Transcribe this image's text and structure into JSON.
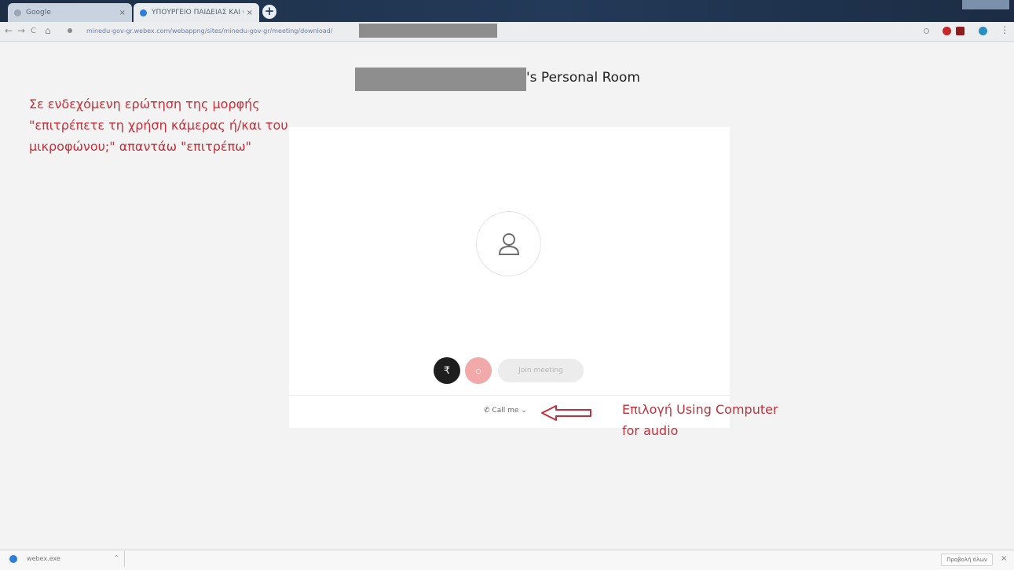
{
  "browser": {
    "tabs": [
      {
        "label": "Google",
        "active": false
      },
      {
        "label": "ΥΠΟΥΡΓΕΙΟ ΠΑΙΔΕΙΑΣ ΚΑΙ ΘΡΗΣ",
        "active": true
      }
    ],
    "new_tab_label": "+",
    "tab_close_label": "×",
    "url": "minedu-gov-gr.webex.com/webappng/sites/minedu-gov-gr/meeting/download/",
    "nav": {
      "back": "←",
      "forward": "→",
      "reload": "C",
      "home": "⌂"
    },
    "menu": "⋮"
  },
  "page": {
    "title_suffix": "'s Personal Room",
    "join_button": "Join meeting",
    "mic_icon": "₹",
    "video_icon": "○",
    "audio_option": "Call me",
    "audio_caret": "⌄"
  },
  "annotations": {
    "permission_note": [
      "Σε ενδεχόμενη ερώτηση της μορφής",
      "\"επιτρέπετε τη χρήση κάμερας ή/και του",
      "μικροφώνου;\" απαντάω \"επιτρέπω\""
    ],
    "audio_note": [
      "Επιλογή Using Computer",
      "for audio"
    ],
    "color": "#c2313b"
  },
  "download_bar": {
    "file_name": "webex.exe",
    "caret": "⌃",
    "show_all": "Προβολή όλων",
    "close": "×"
  }
}
